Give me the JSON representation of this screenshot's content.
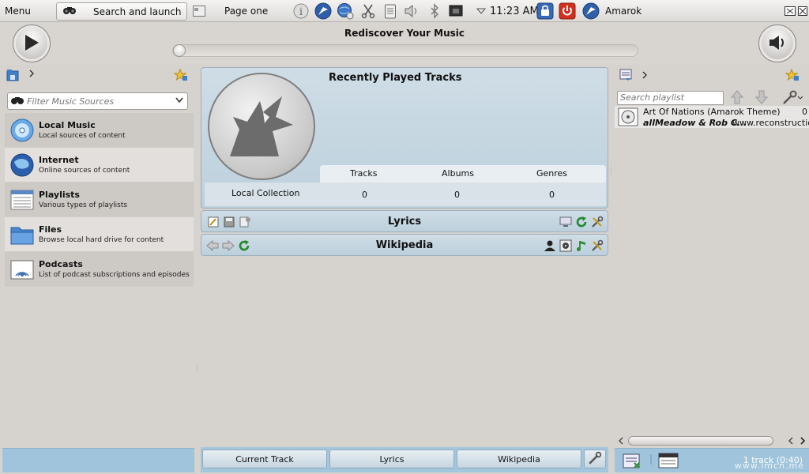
{
  "topbar": {
    "menu_label": "Menu",
    "launch_label": "Search and launch",
    "page_label": "Page one",
    "clock": "11:23 AM",
    "active_task": "Amarok"
  },
  "player": {
    "title": "Rediscover Your Music",
    "seek_position": 0
  },
  "left": {
    "filter_placeholder": "Filter Music Sources",
    "categories": [
      {
        "name": "Local Music",
        "desc": "Local sources of content",
        "icon": "local-music-icon"
      },
      {
        "name": "Internet",
        "desc": "Online sources of content",
        "icon": "globe-icon"
      },
      {
        "name": "Playlists",
        "desc": "Various types of playlists",
        "icon": "playlist-icon"
      },
      {
        "name": "Files",
        "desc": "Browse local hard drive for content",
        "icon": "folder-icon"
      },
      {
        "name": "Podcasts",
        "desc": "List of podcast subscriptions and episodes",
        "icon": "podcast-icon"
      }
    ]
  },
  "center": {
    "recent_title": "Recently Played Tracks",
    "stats_headers": [
      "Tracks",
      "Albums",
      "Genres"
    ],
    "collection_label": "Local Collection",
    "stats_values": [
      "0",
      "0",
      "0"
    ],
    "lyrics_title": "Lyrics",
    "wiki_title": "Wikipedia",
    "tabs": [
      "Current Track",
      "Lyrics",
      "Wikipedia"
    ]
  },
  "right": {
    "search_placeholder": "Search playlist",
    "tracks": [
      {
        "title": "Art Of Nations (Amarok Theme)",
        "artist": "allMeadow & Rob C...",
        "album": "www.reconstructio",
        "length": "0"
      }
    ],
    "track_count": "1 track (0:40)"
  },
  "watermark": "www.imcn.me",
  "colors": {
    "accent_blue": "#9fc4dc",
    "applet_bg": "#bcd0dc",
    "panel_bg": "#d6d2ce"
  }
}
